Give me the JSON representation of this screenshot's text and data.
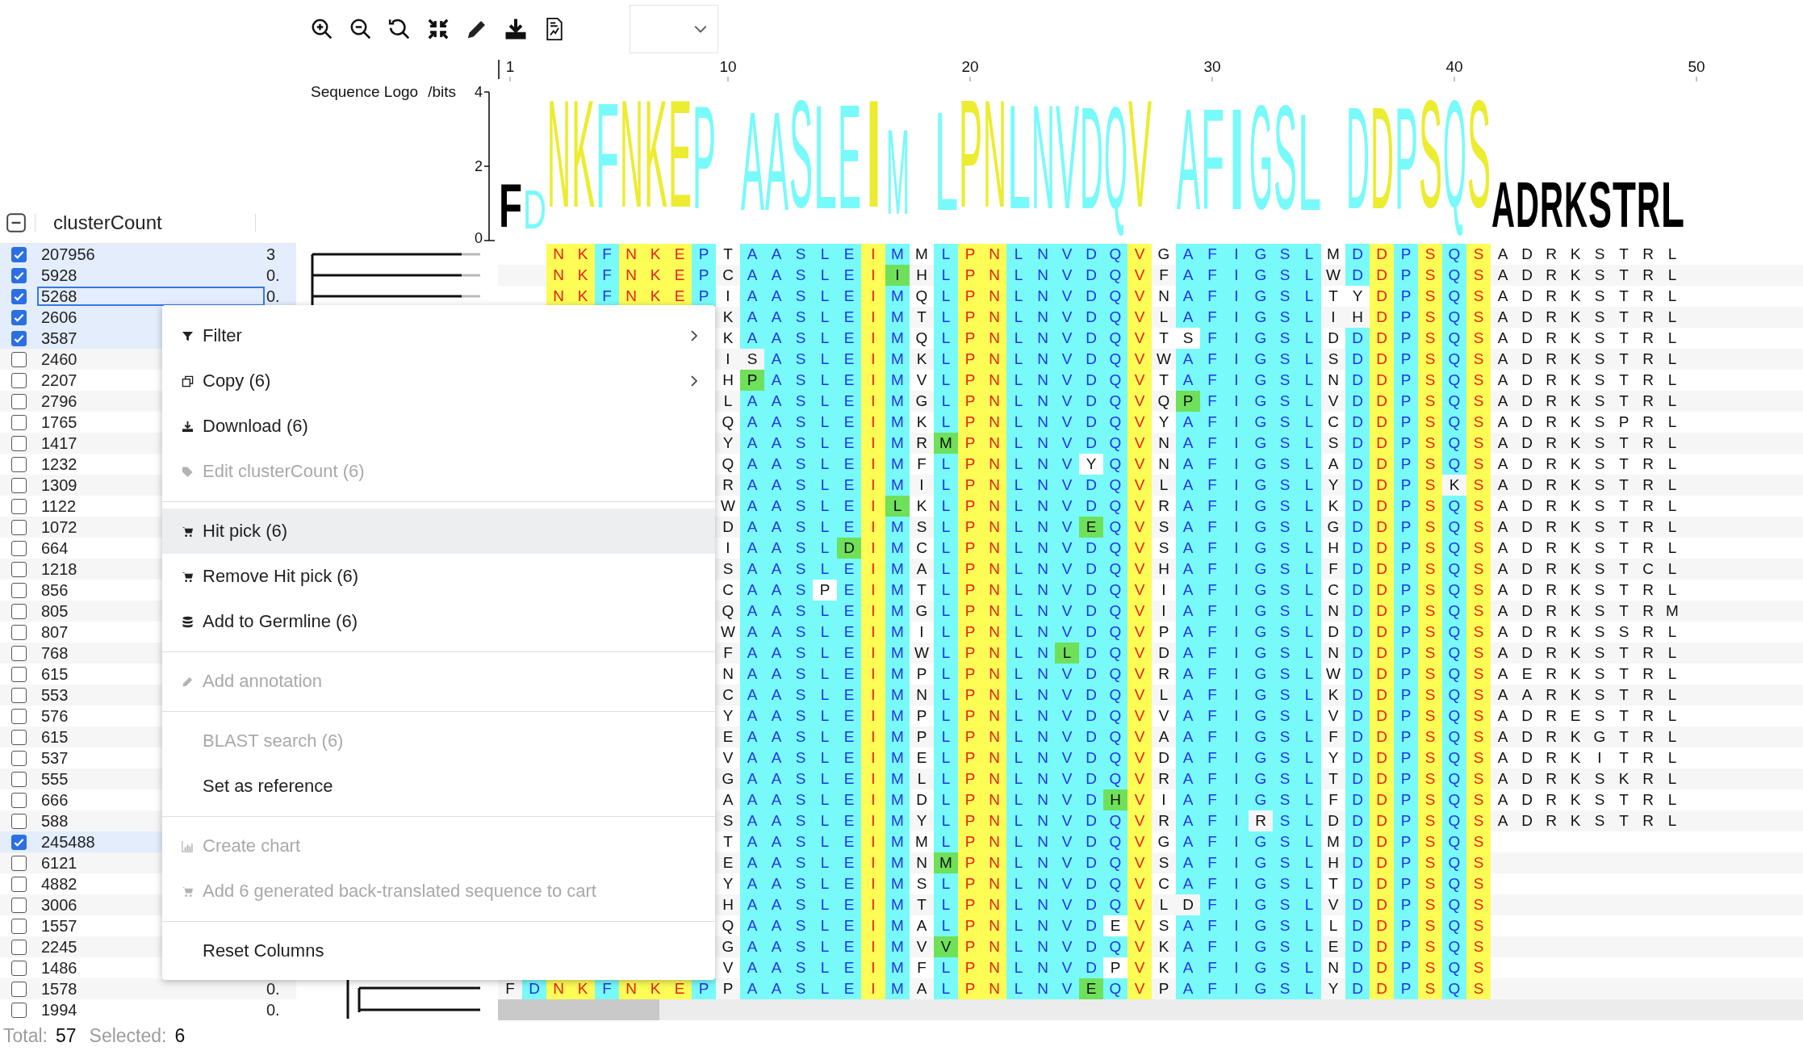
{
  "logo": {
    "title": "Sequence Logo",
    "unit": "/bits",
    "yticks": [
      "4",
      "2",
      "0"
    ],
    "ruler": [
      "1",
      "10",
      "20",
      "30",
      "40",
      "50"
    ],
    "runs": [
      [
        {
          "letter": "F",
          "level": 0.4,
          "color": "#000000"
        },
        {
          "letter": "D",
          "level": 0.36,
          "color": "#78fafa"
        },
        {
          "letter": "N",
          "level": 1,
          "color": "#ecec30"
        },
        {
          "letter": "K",
          "level": 1,
          "color": "#ecec30"
        },
        {
          "letter": "F",
          "level": 0.98,
          "color": "#78fafa"
        },
        {
          "letter": "N",
          "level": 1,
          "color": "#ecec30"
        },
        {
          "letter": "K",
          "level": 1,
          "color": "#ecec30"
        },
        {
          "letter": "E",
          "level": 1,
          "color": "#ecec30"
        },
        {
          "letter": "P",
          "level": 0.96,
          "color": "#78fafa"
        }
      ],
      [
        {
          "letter": "A",
          "level": 0.92,
          "color": "#78fafa"
        },
        {
          "letter": "A",
          "level": 0.92,
          "color": "#78fafa"
        },
        {
          "letter": "S",
          "level": 1,
          "color": "#78fafa"
        },
        {
          "letter": "L",
          "level": 0.97,
          "color": "#78fafa"
        },
        {
          "letter": "E",
          "level": 0.97,
          "color": "#78fafa"
        },
        {
          "letter": "I",
          "level": 1,
          "color": "#ecec30"
        },
        {
          "letter": "M",
          "level": 0.79,
          "color": "#78fafa"
        }
      ],
      [
        {
          "letter": "L",
          "level": 0.92,
          "color": "#78fafa"
        },
        {
          "letter": "P",
          "level": 1,
          "color": "#ecec30"
        },
        {
          "letter": "N",
          "level": 1,
          "color": "#ecec30"
        },
        {
          "letter": "L",
          "level": 0.97,
          "color": "#78fafa"
        },
        {
          "letter": "N",
          "level": 0.97,
          "color": "#78fafa"
        },
        {
          "letter": "V",
          "level": 0.97,
          "color": "#78fafa"
        },
        {
          "letter": "D",
          "level": 0.95,
          "color": "#78fafa"
        },
        {
          "letter": "Q",
          "level": 0.95,
          "color": "#78fafa"
        },
        {
          "letter": "V",
          "level": 1,
          "color": "#ecec30"
        }
      ],
      [
        {
          "letter": "A",
          "level": 0.94,
          "color": "#78fafa"
        },
        {
          "letter": "F",
          "level": 0.94,
          "color": "#78fafa"
        },
        {
          "letter": "I",
          "level": 0.94,
          "color": "#78fafa"
        },
        {
          "letter": "G",
          "level": 0.97,
          "color": "#78fafa"
        },
        {
          "letter": "S",
          "level": 0.97,
          "color": "#78fafa"
        },
        {
          "letter": "L",
          "level": 0.9,
          "color": "#78fafa"
        }
      ],
      [
        {
          "letter": "D",
          "level": 0.95,
          "color": "#78fafa"
        },
        {
          "letter": "D",
          "level": 0.95,
          "color": "#ecec30"
        },
        {
          "letter": "P",
          "level": 0.95,
          "color": "#78fafa"
        },
        {
          "letter": "S",
          "level": 1,
          "color": "#ecec30"
        },
        {
          "letter": "Q",
          "level": 1,
          "color": "#78fafa"
        },
        {
          "letter": "S",
          "level": 1,
          "color": "#ecec30"
        },
        {
          "letter": "A",
          "level": 0.42,
          "color": "#000000"
        },
        {
          "letter": "D",
          "level": 0.42,
          "color": "#000000"
        },
        {
          "letter": "R",
          "level": 0.42,
          "color": "#000000"
        },
        {
          "letter": "K",
          "level": 0.42,
          "color": "#000000"
        },
        {
          "letter": "S",
          "level": 0.42,
          "color": "#000000"
        },
        {
          "letter": "T",
          "level": 0.42,
          "color": "#000000"
        },
        {
          "letter": "R",
          "level": 0.42,
          "color": "#000000"
        },
        {
          "letter": "L",
          "level": 0.42,
          "color": "#000000"
        }
      ]
    ]
  },
  "alignment": {
    "columns": [
      {
        "kind": "variable"
      },
      {
        "kind": "conserved",
        "color": "#78fafa"
      },
      {
        "kind": "conserved",
        "color": "#fdfd55"
      },
      {
        "kind": "conserved",
        "color": "#fdfd55"
      },
      {
        "kind": "conserved",
        "color": "#78fafa"
      },
      {
        "kind": "conserved",
        "color": "#fdfd55"
      },
      {
        "kind": "conserved",
        "color": "#fdfd55"
      },
      {
        "kind": "conserved",
        "color": "#fdfd55"
      },
      {
        "kind": "conserved",
        "color": "#78fafa"
      },
      {
        "kind": "variable"
      },
      {
        "kind": "conserved",
        "color": "#78fafa"
      },
      {
        "kind": "conserved",
        "color": "#78fafa"
      },
      {
        "kind": "conserved",
        "color": "#78fafa"
      },
      {
        "kind": "conserved",
        "color": "#78fafa"
      },
      {
        "kind": "conserved",
        "color": "#78fafa"
      },
      {
        "kind": "conserved",
        "color": "#fdfd55"
      },
      {
        "kind": "conserved",
        "color": "#78fafa"
      },
      {
        "kind": "variable"
      },
      {
        "kind": "conserved",
        "color": "#78fafa"
      },
      {
        "kind": "conserved",
        "color": "#fdfd55"
      },
      {
        "kind": "conserved",
        "color": "#fdfd55"
      },
      {
        "kind": "conserved",
        "color": "#78fafa"
      },
      {
        "kind": "conserved",
        "color": "#78fafa"
      },
      {
        "kind": "conserved",
        "color": "#78fafa"
      },
      {
        "kind": "conserved",
        "color": "#78fafa"
      },
      {
        "kind": "conserved",
        "color": "#78fafa"
      },
      {
        "kind": "conserved",
        "color": "#fdfd55"
      },
      {
        "kind": "variable"
      },
      {
        "kind": "conserved",
        "color": "#78fafa"
      },
      {
        "kind": "conserved",
        "color": "#78fafa"
      },
      {
        "kind": "conserved",
        "color": "#78fafa"
      },
      {
        "kind": "conserved",
        "color": "#78fafa"
      },
      {
        "kind": "conserved",
        "color": "#78fafa"
      },
      {
        "kind": "conserved",
        "color": "#78fafa"
      },
      {
        "kind": "variable"
      },
      {
        "kind": "conserved",
        "color": "#78fafa"
      },
      {
        "kind": "conserved",
        "color": "#fdfd55"
      },
      {
        "kind": "conserved",
        "color": "#78fafa"
      },
      {
        "kind": "conserved",
        "color": "#fdfd55"
      },
      {
        "kind": "conserved",
        "color": "#78fafa"
      },
      {
        "kind": "conserved",
        "color": "#fdfd55"
      },
      {
        "kind": "variable"
      },
      {
        "kind": "variable"
      },
      {
        "kind": "variable"
      },
      {
        "kind": "variable"
      },
      {
        "kind": "variable"
      },
      {
        "kind": "variable"
      },
      {
        "kind": "variable"
      },
      {
        "kind": "variable"
      }
    ]
  },
  "table": {
    "select_all": {
      "indeterminate": true
    },
    "columns": [
      "clusterCount"
    ],
    "rows": [
      {
        "cluster_count": "207956",
        "column_2": "3",
        "checked": true,
        "focused": false,
        "kind": "gapped",
        "residues": [
          "N",
          "K",
          "F",
          "N",
          "K",
          "E",
          "P",
          "T",
          "A",
          "A",
          "S",
          "L",
          "E",
          "I",
          "M",
          "M",
          "L",
          "P",
          "N",
          "L",
          "N",
          "V",
          "D",
          "Q",
          "V",
          "G",
          "A",
          "F",
          "I",
          "G",
          "S",
          "L",
          "M",
          "D",
          "D",
          "P",
          "S",
          "Q",
          "S",
          "A",
          "D",
          "R",
          "K",
          "S",
          "T",
          "R",
          "L"
        ]
      },
      {
        "cluster_count": "5928",
        "column_2": "0.",
        "checked": true,
        "focused": false,
        "kind": "gapped",
        "residues": [
          "N",
          "K",
          "F",
          "N",
          "K",
          "E",
          "P",
          "C",
          "A",
          "A",
          "S",
          "L",
          "E",
          "I",
          {
            "residue": "I",
            "kind": "similar"
          },
          "H",
          "L",
          "P",
          "N",
          "L",
          "N",
          "V",
          "D",
          "Q",
          "V",
          "F",
          "A",
          "F",
          "I",
          "G",
          "S",
          "L",
          "W",
          "D",
          "D",
          "P",
          "S",
          "Q",
          "S",
          "A",
          "D",
          "R",
          "K",
          "S",
          "T",
          "R",
          "L"
        ]
      },
      {
        "cluster_count": "5268",
        "column_2": "0.",
        "checked": true,
        "focused": true,
        "kind": "gapped",
        "residues": [
          "N",
          "K",
          "F",
          "N",
          "K",
          "E",
          "P",
          "I",
          "A",
          "A",
          "S",
          "L",
          "E",
          "I",
          "M",
          "Q",
          "L",
          "P",
          "N",
          "L",
          "N",
          "V",
          "D",
          "Q",
          "V",
          "N",
          "A",
          "F",
          "I",
          "G",
          "S",
          "L",
          "T",
          {
            "residue": "Y",
            "kind": "different"
          },
          "D",
          "P",
          "S",
          "Q",
          "S",
          "A",
          "D",
          "R",
          "K",
          "S",
          "T",
          "R",
          "L"
        ]
      },
      {
        "cluster_count": "2606",
        "checked": true,
        "focused": false,
        "kind": "covered",
        "residues": [
          "K",
          "A",
          "A",
          "S",
          "L",
          "E",
          "I",
          "M",
          "T",
          "L",
          "P",
          "N",
          "L",
          "N",
          "V",
          "D",
          "Q",
          "V",
          "L",
          "A",
          "F",
          "I",
          "G",
          "S",
          "L",
          "I",
          {
            "residue": "H",
            "kind": "different"
          },
          "D",
          "P",
          "S",
          "Q",
          "S",
          "A",
          "D",
          "R",
          "K",
          "S",
          "T",
          "R",
          "L"
        ]
      },
      {
        "cluster_count": "3587",
        "checked": true,
        "focused": false,
        "kind": "covered",
        "residues": [
          "K",
          "A",
          "A",
          "S",
          "L",
          "E",
          "I",
          "M",
          "Q",
          "L",
          "P",
          "N",
          "L",
          "N",
          "V",
          "D",
          "Q",
          "V",
          "T",
          {
            "residue": "S",
            "kind": "different"
          },
          "F",
          "I",
          "G",
          "S",
          "L",
          "D",
          "D",
          "D",
          "P",
          "S",
          "Q",
          "S",
          "A",
          "D",
          "R",
          "K",
          "S",
          "T",
          "R",
          "L"
        ]
      },
      {
        "cluster_count": "2460",
        "checked": false,
        "focused": false,
        "kind": "covered",
        "residues": [
          "I",
          {
            "residue": "S",
            "kind": "different"
          },
          "A",
          "S",
          "L",
          "E",
          "I",
          "M",
          "K",
          "L",
          "P",
          "N",
          "L",
          "N",
          "V",
          "D",
          "Q",
          "V",
          "W",
          "A",
          "F",
          "I",
          "G",
          "S",
          "L",
          "S",
          "D",
          "D",
          "P",
          "S",
          "Q",
          "S",
          "A",
          "D",
          "R",
          "K",
          "S",
          "T",
          "R",
          "L"
        ]
      },
      {
        "cluster_count": "2207",
        "checked": false,
        "focused": false,
        "kind": "covered",
        "residues": [
          "H",
          {
            "residue": "P",
            "kind": "similar"
          },
          "A",
          "S",
          "L",
          "E",
          "I",
          "M",
          "V",
          "L",
          "P",
          "N",
          "L",
          "N",
          "V",
          "D",
          "Q",
          "V",
          "T",
          "A",
          "F",
          "I",
          "G",
          "S",
          "L",
          "N",
          "D",
          "D",
          "P",
          "S",
          "Q",
          "S",
          "A",
          "D",
          "R",
          "K",
          "S",
          "T",
          "R",
          "L"
        ]
      },
      {
        "cluster_count": "2796",
        "checked": false,
        "focused": false,
        "kind": "covered",
        "residues": [
          "L",
          "A",
          "A",
          "S",
          "L",
          "E",
          "I",
          "M",
          "G",
          "L",
          "P",
          "N",
          "L",
          "N",
          "V",
          "D",
          "Q",
          "V",
          "Q",
          {
            "residue": "P",
            "kind": "similar"
          },
          "F",
          "I",
          "G",
          "S",
          "L",
          "V",
          "D",
          "D",
          "P",
          "S",
          "Q",
          "S",
          "A",
          "D",
          "R",
          "K",
          "S",
          "T",
          "R",
          "L"
        ]
      },
      {
        "cluster_count": "1765",
        "checked": false,
        "focused": false,
        "kind": "covered",
        "residues": [
          "Q",
          "A",
          "A",
          "S",
          "L",
          "E",
          "I",
          "M",
          "K",
          "L",
          "P",
          "N",
          "L",
          "N",
          "V",
          "D",
          "Q",
          "V",
          "Y",
          "A",
          "F",
          "I",
          "G",
          "S",
          "L",
          "C",
          "D",
          "D",
          "P",
          "S",
          "Q",
          "S",
          "A",
          "D",
          "R",
          "K",
          "S",
          "P",
          "R",
          "L"
        ]
      },
      {
        "cluster_count": "1417",
        "checked": false,
        "focused": false,
        "kind": "covered",
        "residues": [
          "Y",
          "A",
          "A",
          "S",
          "L",
          "E",
          "I",
          "M",
          "R",
          {
            "residue": "M",
            "kind": "similar"
          },
          "P",
          "N",
          "L",
          "N",
          "V",
          "D",
          "Q",
          "V",
          "N",
          "A",
          "F",
          "I",
          "G",
          "S",
          "L",
          "S",
          "D",
          "D",
          "P",
          "S",
          "Q",
          "S",
          "A",
          "D",
          "R",
          "K",
          "S",
          "T",
          "R",
          "L"
        ]
      },
      {
        "cluster_count": "1232",
        "checked": false,
        "focused": false,
        "kind": "covered",
        "residues": [
          "Q",
          "A",
          "A",
          "S",
          "L",
          "E",
          "I",
          "M",
          "F",
          "L",
          "P",
          "N",
          "L",
          "N",
          "V",
          {
            "residue": "Y",
            "kind": "different"
          },
          "Q",
          "V",
          "N",
          "A",
          "F",
          "I",
          "G",
          "S",
          "L",
          "A",
          "D",
          "D",
          "P",
          "S",
          "Q",
          "S",
          "A",
          "D",
          "R",
          "K",
          "S",
          "T",
          "R",
          "L"
        ]
      },
      {
        "cluster_count": "1309",
        "checked": false,
        "focused": false,
        "kind": "covered",
        "residues": [
          "R",
          "A",
          "A",
          "S",
          "L",
          "E",
          "I",
          "M",
          "I",
          "L",
          "P",
          "N",
          "L",
          "N",
          "V",
          "D",
          "Q",
          "V",
          "L",
          "A",
          "F",
          "I",
          "G",
          "S",
          "L",
          "Y",
          "D",
          "D",
          "P",
          "S",
          {
            "residue": "K",
            "kind": "different"
          },
          "S",
          "A",
          "D",
          "R",
          "K",
          "S",
          "T",
          "R",
          "L"
        ]
      },
      {
        "cluster_count": "1122",
        "checked": false,
        "focused": false,
        "kind": "covered",
        "residues": [
          "W",
          "A",
          "A",
          "S",
          "L",
          "E",
          "I",
          {
            "residue": "L",
            "kind": "similar"
          },
          "K",
          "L",
          "P",
          "N",
          "L",
          "N",
          "V",
          "D",
          "Q",
          "V",
          "R",
          "A",
          "F",
          "I",
          "G",
          "S",
          "L",
          "K",
          "D",
          "D",
          "P",
          "S",
          "Q",
          "S",
          "A",
          "D",
          "R",
          "K",
          "S",
          "T",
          "R",
          "L"
        ]
      },
      {
        "cluster_count": "1072",
        "checked": false,
        "focused": false,
        "kind": "covered",
        "residues": [
          "D",
          "A",
          "A",
          "S",
          "L",
          "E",
          "I",
          "M",
          "S",
          "L",
          "P",
          "N",
          "L",
          "N",
          "V",
          {
            "residue": "E",
            "kind": "similar"
          },
          "Q",
          "V",
          "S",
          "A",
          "F",
          "I",
          "G",
          "S",
          "L",
          "G",
          "D",
          "D",
          "P",
          "S",
          "Q",
          "S",
          "A",
          "D",
          "R",
          "K",
          "S",
          "T",
          "R",
          "L"
        ]
      },
      {
        "cluster_count": "664",
        "checked": false,
        "focused": false,
        "kind": "covered",
        "residues": [
          "I",
          "A",
          "A",
          "S",
          "L",
          {
            "residue": "D",
            "kind": "similar"
          },
          "I",
          "M",
          "C",
          "L",
          "P",
          "N",
          "L",
          "N",
          "V",
          "D",
          "Q",
          "V",
          "S",
          "A",
          "F",
          "I",
          "G",
          "S",
          "L",
          "H",
          "D",
          "D",
          "P",
          "S",
          "Q",
          "S",
          "A",
          "D",
          "R",
          "K",
          "S",
          "T",
          "R",
          "L"
        ]
      },
      {
        "cluster_count": "1218",
        "checked": false,
        "focused": false,
        "kind": "covered",
        "residues": [
          "S",
          "A",
          "A",
          "S",
          "L",
          "E",
          "I",
          "M",
          "A",
          "L",
          "P",
          "N",
          "L",
          "N",
          "V",
          "D",
          "Q",
          "V",
          "H",
          "A",
          "F",
          "I",
          "G",
          "S",
          "L",
          "F",
          "D",
          "D",
          "P",
          "S",
          "Q",
          "S",
          "A",
          "D",
          "R",
          "K",
          "S",
          "T",
          "C",
          "L"
        ]
      },
      {
        "cluster_count": "856",
        "checked": false,
        "focused": false,
        "kind": "covered",
        "residues": [
          "C",
          "A",
          "A",
          "S",
          {
            "residue": "P",
            "kind": "different"
          },
          "E",
          "I",
          "M",
          "T",
          "L",
          "P",
          "N",
          "L",
          "N",
          "V",
          "D",
          "Q",
          "V",
          "I",
          "A",
          "F",
          "I",
          "G",
          "S",
          "L",
          "C",
          "D",
          "D",
          "P",
          "S",
          "Q",
          "S",
          "A",
          "D",
          "R",
          "K",
          "S",
          "T",
          "R",
          "L"
        ]
      },
      {
        "cluster_count": "805",
        "checked": false,
        "focused": false,
        "kind": "covered",
        "residues": [
          "Q",
          "A",
          "A",
          "S",
          "L",
          "E",
          "I",
          "M",
          "G",
          "L",
          "P",
          "N",
          "L",
          "N",
          "V",
          "D",
          "Q",
          "V",
          "I",
          "A",
          "F",
          "I",
          "G",
          "S",
          "L",
          "N",
          "D",
          "D",
          "P",
          "S",
          "Q",
          "S",
          "A",
          "D",
          "R",
          "K",
          "S",
          "T",
          "R",
          "M"
        ]
      },
      {
        "cluster_count": "807",
        "checked": false,
        "focused": false,
        "kind": "covered",
        "residues": [
          "W",
          "A",
          "A",
          "S",
          "L",
          "E",
          "I",
          "M",
          "I",
          "L",
          "P",
          "N",
          "L",
          "N",
          "V",
          "D",
          "Q",
          "V",
          "P",
          "A",
          "F",
          "I",
          "G",
          "S",
          "L",
          "D",
          "D",
          "D",
          "P",
          "S",
          "Q",
          "S",
          "A",
          "D",
          "R",
          "K",
          "S",
          "S",
          "R",
          "L"
        ]
      },
      {
        "cluster_count": "768",
        "checked": false,
        "focused": false,
        "kind": "covered",
        "residues": [
          "F",
          "A",
          "A",
          "S",
          "L",
          "E",
          "I",
          "M",
          "W",
          "L",
          "P",
          "N",
          "L",
          "N",
          {
            "residue": "L",
            "kind": "similar"
          },
          "D",
          "Q",
          "V",
          "D",
          "A",
          "F",
          "I",
          "G",
          "S",
          "L",
          "N",
          "D",
          "D",
          "P",
          "S",
          "Q",
          "S",
          "A",
          "D",
          "R",
          "K",
          "S",
          "T",
          "R",
          "L"
        ]
      },
      {
        "cluster_count": "615",
        "checked": false,
        "focused": false,
        "kind": "covered",
        "residues": [
          "N",
          "A",
          "A",
          "S",
          "L",
          "E",
          "I",
          "M",
          "P",
          "L",
          "P",
          "N",
          "L",
          "N",
          "V",
          "D",
          "Q",
          "V",
          "R",
          "A",
          "F",
          "I",
          "G",
          "S",
          "L",
          "W",
          "D",
          "D",
          "P",
          "S",
          "Q",
          "S",
          "A",
          "E",
          "R",
          "K",
          "S",
          "T",
          "R",
          "L"
        ]
      },
      {
        "cluster_count": "553",
        "checked": false,
        "focused": false,
        "kind": "covered",
        "residues": [
          "C",
          "A",
          "A",
          "S",
          "L",
          "E",
          "I",
          "M",
          "N",
          "L",
          "P",
          "N",
          "L",
          "N",
          "V",
          "D",
          "Q",
          "V",
          "L",
          "A",
          "F",
          "I",
          "G",
          "S",
          "L",
          "K",
          "D",
          "D",
          "P",
          "S",
          "Q",
          "S",
          "A",
          "A",
          "R",
          "K",
          "S",
          "T",
          "R",
          "L"
        ]
      },
      {
        "cluster_count": "576",
        "checked": false,
        "focused": false,
        "kind": "covered",
        "residues": [
          "Y",
          "A",
          "A",
          "S",
          "L",
          "E",
          "I",
          "M",
          "P",
          "L",
          "P",
          "N",
          "L",
          "N",
          "V",
          "D",
          "Q",
          "V",
          "V",
          "A",
          "F",
          "I",
          "G",
          "S",
          "L",
          "V",
          "D",
          "D",
          "P",
          "S",
          "Q",
          "S",
          "A",
          "D",
          "R",
          "E",
          "S",
          "T",
          "R",
          "L"
        ]
      },
      {
        "cluster_count": "615",
        "checked": false,
        "focused": false,
        "kind": "covered",
        "residues": [
          "E",
          "A",
          "A",
          "S",
          "L",
          "E",
          "I",
          "M",
          "P",
          "L",
          "P",
          "N",
          "L",
          "N",
          "V",
          "D",
          "Q",
          "V",
          "A",
          "A",
          "F",
          "I",
          "G",
          "S",
          "L",
          "F",
          "D",
          "D",
          "P",
          "S",
          "Q",
          "S",
          "A",
          "D",
          "R",
          "K",
          "G",
          "T",
          "R",
          "L"
        ]
      },
      {
        "cluster_count": "537",
        "checked": false,
        "focused": false,
        "kind": "covered",
        "residues": [
          "V",
          "A",
          "A",
          "S",
          "L",
          "E",
          "I",
          "M",
          "E",
          "L",
          "P",
          "N",
          "L",
          "N",
          "V",
          "D",
          "Q",
          "V",
          "D",
          "A",
          "F",
          "I",
          "G",
          "S",
          "L",
          "Y",
          "D",
          "D",
          "P",
          "S",
          "Q",
          "S",
          "A",
          "D",
          "R",
          "K",
          "I",
          "T",
          "R",
          "L"
        ]
      },
      {
        "cluster_count": "555",
        "checked": false,
        "focused": false,
        "kind": "covered",
        "residues": [
          "G",
          "A",
          "A",
          "S",
          "L",
          "E",
          "I",
          "M",
          "L",
          "L",
          "P",
          "N",
          "L",
          "N",
          "V",
          "D",
          "Q",
          "V",
          "R",
          "A",
          "F",
          "I",
          "G",
          "S",
          "L",
          "T",
          "D",
          "D",
          "P",
          "S",
          "Q",
          "S",
          "A",
          "D",
          "R",
          "K",
          "S",
          "K",
          "R",
          "L"
        ]
      },
      {
        "cluster_count": "666",
        "checked": false,
        "focused": false,
        "kind": "covered",
        "residues": [
          "A",
          "A",
          "A",
          "S",
          "L",
          "E",
          "I",
          "M",
          "D",
          "L",
          "P",
          "N",
          "L",
          "N",
          "V",
          "D",
          {
            "residue": "H",
            "kind": "similar"
          },
          "V",
          "I",
          "A",
          "F",
          "I",
          "G",
          "S",
          "L",
          "F",
          "D",
          "D",
          "P",
          "S",
          "Q",
          "S",
          "A",
          "D",
          "R",
          "K",
          "S",
          "T",
          "R",
          "L"
        ]
      },
      {
        "cluster_count": "588",
        "checked": false,
        "focused": false,
        "kind": "covered",
        "residues": [
          "S",
          "A",
          "A",
          "S",
          "L",
          "E",
          "I",
          "M",
          "Y",
          "L",
          "P",
          "N",
          "L",
          "N",
          "V",
          "D",
          "Q",
          "V",
          "R",
          "A",
          "F",
          "I",
          {
            "residue": "R",
            "kind": "different"
          },
          "S",
          "L",
          "D",
          "D",
          "D",
          "P",
          "S",
          "Q",
          "S",
          "A",
          "D",
          "R",
          "K",
          "S",
          "T",
          "R",
          "L"
        ]
      },
      {
        "cluster_count": "245488",
        "checked": true,
        "focused": false,
        "kind": "covered",
        "residues": [
          "T",
          "A",
          "A",
          "S",
          "L",
          "E",
          "I",
          "M",
          "M",
          "L",
          "P",
          "N",
          "L",
          "N",
          "V",
          "D",
          "Q",
          "V",
          "G",
          "A",
          "F",
          "I",
          "G",
          "S",
          "L",
          "M",
          "D",
          "D",
          "P",
          "S",
          "Q",
          "S"
        ]
      },
      {
        "cluster_count": "6121",
        "checked": false,
        "focused": false,
        "kind": "covered",
        "residues": [
          "E",
          "A",
          "A",
          "S",
          "L",
          "E",
          "I",
          "M",
          "N",
          {
            "residue": "M",
            "kind": "similar"
          },
          "P",
          "N",
          "L",
          "N",
          "V",
          "D",
          "Q",
          "V",
          "S",
          "A",
          "F",
          "I",
          "G",
          "S",
          "L",
          "H",
          "D",
          "D",
          "P",
          "S",
          "Q",
          "S"
        ]
      },
      {
        "cluster_count": "4882",
        "checked": false,
        "focused": false,
        "kind": "covered",
        "residues": [
          "Y",
          "A",
          "A",
          "S",
          "L",
          "E",
          "I",
          "M",
          "S",
          "L",
          "P",
          "N",
          "L",
          "N",
          "V",
          "D",
          "Q",
          "V",
          "C",
          "A",
          "F",
          "I",
          "G",
          "S",
          "L",
          "T",
          "D",
          "D",
          "P",
          "S",
          "Q",
          "S"
        ]
      },
      {
        "cluster_count": "3006",
        "checked": false,
        "focused": false,
        "kind": "covered",
        "residues": [
          "H",
          "A",
          "A",
          "S",
          "L",
          "E",
          "I",
          "M",
          "T",
          "L",
          "P",
          "N",
          "L",
          "N",
          "V",
          "D",
          "Q",
          "V",
          "L",
          {
            "residue": "D",
            "kind": "different"
          },
          "F",
          "I",
          "G",
          "S",
          "L",
          "V",
          "D",
          "D",
          "P",
          "S",
          "Q",
          "S"
        ]
      },
      {
        "cluster_count": "1557",
        "checked": false,
        "focused": false,
        "kind": "covered",
        "residues": [
          "Q",
          "A",
          "A",
          "S",
          "L",
          "E",
          "I",
          "M",
          "A",
          "L",
          "P",
          "N",
          "L",
          "N",
          "V",
          "D",
          {
            "residue": "E",
            "kind": "different"
          },
          "V",
          "S",
          "A",
          "F",
          "I",
          "G",
          "S",
          "L",
          "L",
          "D",
          "D",
          "P",
          "S",
          "Q",
          "S"
        ]
      },
      {
        "cluster_count": "2245",
        "checked": false,
        "focused": false,
        "kind": "covered",
        "residues": [
          "G",
          "A",
          "A",
          "S",
          "L",
          "E",
          "I",
          "M",
          "V",
          {
            "residue": "V",
            "kind": "similar"
          },
          "P",
          "N",
          "L",
          "N",
          "V",
          "D",
          "Q",
          "V",
          "K",
          "A",
          "F",
          "I",
          "G",
          "S",
          "L",
          "E",
          "D",
          "D",
          "P",
          "S",
          "Q",
          "S"
        ]
      },
      {
        "cluster_count": "1486",
        "checked": false,
        "focused": false,
        "kind": "covered",
        "residues": [
          "V",
          "A",
          "A",
          "S",
          "L",
          "E",
          "I",
          "M",
          "F",
          "L",
          "P",
          "N",
          "L",
          "N",
          "V",
          "D",
          {
            "residue": "P",
            "kind": "different"
          },
          "V",
          "K",
          "A",
          "F",
          "I",
          "G",
          "S",
          "L",
          "N",
          "D",
          "D",
          "P",
          "S",
          "Q",
          "S"
        ]
      },
      {
        "cluster_count": "1578",
        "column_2": "0.",
        "checked": false,
        "focused": false,
        "kind": "full",
        "residues": [
          "F",
          "D",
          "N",
          "K",
          "F",
          "N",
          "K",
          "E",
          "P",
          "P",
          "A",
          "A",
          "S",
          "L",
          "E",
          "I",
          "M",
          "A",
          "L",
          "P",
          "N",
          "L",
          "N",
          "V",
          {
            "residue": "E",
            "kind": "similar"
          },
          "Q",
          "V",
          "P",
          "A",
          "F",
          "I",
          "G",
          "S",
          "L",
          "Y",
          "D",
          "D",
          "P",
          "S",
          "Q",
          "S"
        ]
      },
      {
        "cluster_count": "1994",
        "column_2": "0.",
        "checked": false,
        "focused": false
      }
    ]
  },
  "menu": {
    "sections": [
      {
        "items": [
          {
            "label": "Filter",
            "disabled": false,
            "selected": false,
            "submenu": true
          },
          {
            "label": "Copy (6)",
            "disabled": false,
            "selected": false,
            "submenu": true
          },
          {
            "label": "Download (6)",
            "disabled": false,
            "selected": false,
            "submenu": false
          },
          {
            "label": "Edit clusterCount (6)",
            "disabled": true,
            "selected": false,
            "submenu": false
          }
        ]
      },
      {
        "items": [
          {
            "label": "Hit pick (6)",
            "disabled": false,
            "selected": true,
            "submenu": false
          },
          {
            "label": "Remove Hit pick (6)",
            "disabled": false,
            "selected": false,
            "submenu": false
          },
          {
            "label": "Add to Germline (6)",
            "disabled": false,
            "selected": false,
            "submenu": false
          }
        ]
      },
      {
        "items": [
          {
            "label": "Add annotation",
            "disabled": true,
            "selected": false,
            "submenu": false
          }
        ]
      },
      {
        "items": [
          {
            "label": "BLAST search (6)",
            "disabled": true,
            "selected": false,
            "submenu": false
          },
          {
            "label": "Set as reference",
            "disabled": false,
            "selected": false,
            "submenu": false
          }
        ]
      },
      {
        "items": [
          {
            "label": "Create chart",
            "disabled": true,
            "selected": false,
            "submenu": false
          },
          {
            "label": "Add 6 generated back-translated sequence to cart",
            "disabled": true,
            "selected": false,
            "submenu": false
          }
        ]
      },
      {
        "items": [
          {
            "label": "Reset Columns",
            "disabled": false,
            "selected": false,
            "submenu": false
          }
        ]
      }
    ]
  },
  "status_bar": {
    "total_label": "Total:",
    "total": "57",
    "selected_label": "Selected:",
    "selected": "6"
  }
}
